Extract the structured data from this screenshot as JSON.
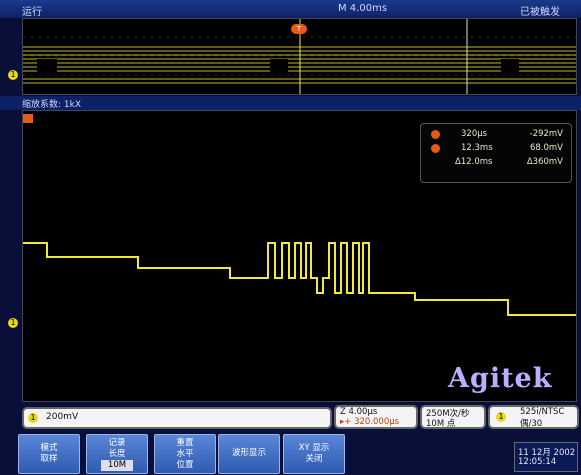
{
  "topbar": {
    "status": "运行",
    "timebase": "M 4.00ms",
    "trigger_state": "已被触发"
  },
  "overview": {
    "trigger_marker": "T"
  },
  "zoombar": {
    "label": "缩放系数: 1kX"
  },
  "cursor_readout": {
    "row1": {
      "time": "320μs",
      "value": "-292mV"
    },
    "row2": {
      "time": "12.3ms",
      "value": "68.0mV"
    },
    "row3": {
      "time": "Δ12.0ms",
      "value": "Δ360mV"
    }
  },
  "main": {
    "channel_marker": "1"
  },
  "status": {
    "ch1_scale": "200mV",
    "zoom_time": "Z 4.00μs",
    "zoom_position": "▸+ 320.000μs",
    "sample_rate": "250M次/秒",
    "record_length": "10M 点",
    "trigger_ch": "1",
    "video_std": "525i/NTSC",
    "field": "偶/30"
  },
  "buttons": [
    {
      "l1": "模式",
      "l2": "取样",
      "l3": ""
    },
    {
      "l1": "记录",
      "l2": "长度",
      "l3": "10M"
    },
    {
      "l1": "重置",
      "l2": "水平",
      "l3": "位置"
    },
    {
      "l1": "波形显示",
      "l2": "",
      "l3": ""
    },
    {
      "l1": "XY 显示",
      "l2": "关闭",
      "l3": ""
    }
  ],
  "datetime": {
    "date": "11 12月 2002",
    "time": "12:05:14"
  },
  "watermark": "Agitek",
  "colors": {
    "trace": "#f2e83a",
    "cursor": "#e85a1a"
  }
}
